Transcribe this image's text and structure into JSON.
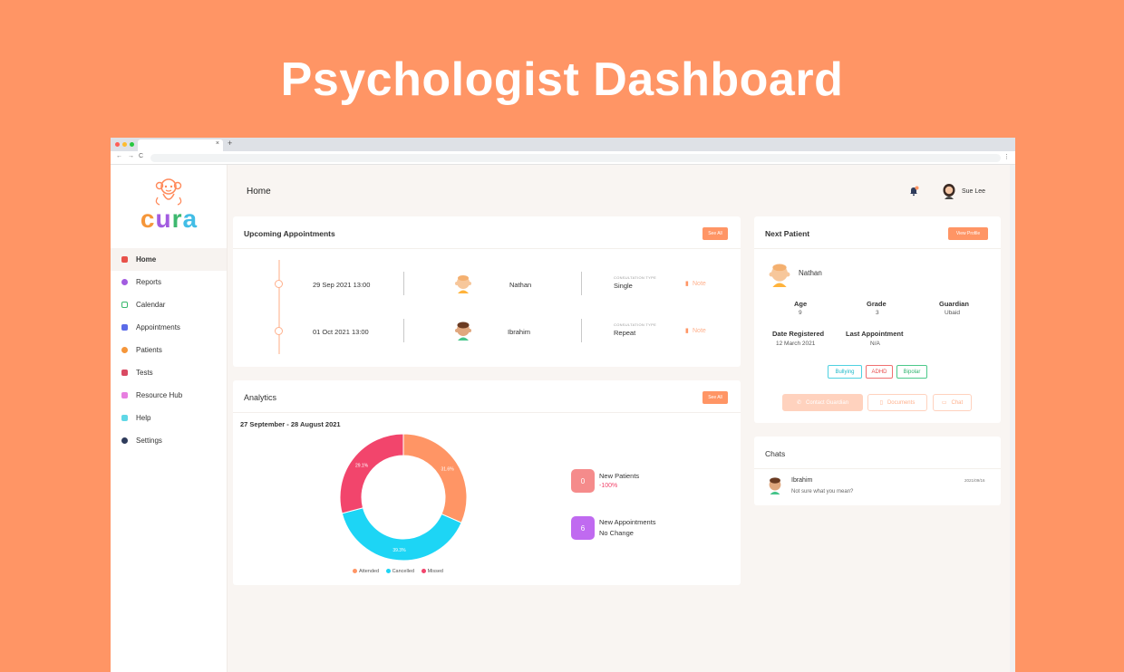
{
  "hero": {
    "title": "Psychologist Dashboard"
  },
  "browser": {
    "tab_close": "×",
    "new_tab": "+",
    "back": "←",
    "forward": "→",
    "reload": "C",
    "menu": "⋮"
  },
  "logo": {
    "text_c": "c",
    "text_u": "u",
    "text_r": "r",
    "text_a": "a"
  },
  "sidebar": {
    "items": [
      {
        "label": "Home",
        "color": "#E8514A"
      },
      {
        "label": "Reports",
        "color": "#A25CE0"
      },
      {
        "label": "Calendar",
        "color": "#37B86B"
      },
      {
        "label": "Appointments",
        "color": "#5B6BE8"
      },
      {
        "label": "Patients",
        "color": "#F5963A"
      },
      {
        "label": "Tests",
        "color": "#D94A63"
      },
      {
        "label": "Resource Hub",
        "color": "#E77FE0"
      },
      {
        "label": "Help",
        "color": "#5FD7E6"
      },
      {
        "label": "Settings",
        "color": "#2E3B5B"
      }
    ]
  },
  "topbar": {
    "title": "Home",
    "user_name": "Sue Lee"
  },
  "upcoming": {
    "title": "Upcoming Appointments",
    "see_all": "See All",
    "type_caption": "CONSULTATION TYPE",
    "note_label": "Note",
    "rows": [
      {
        "datetime": "29 Sep 2021 13:00",
        "patient": "Nathan",
        "type": "Single"
      },
      {
        "datetime": "01 Oct 2021 13:00",
        "patient": "Ibrahim",
        "type": "Repeat"
      }
    ]
  },
  "next_patient": {
    "title": "Next Patient",
    "view_profile": "View Profile",
    "name": "Nathan",
    "age_label": "Age",
    "age": "9",
    "grade_label": "Grade",
    "grade": "3",
    "guardian_label": "Guardian",
    "guardian": "Ubaid",
    "registered_label": "Date Registered",
    "registered": "12 March 2021",
    "last_label": "Last Appointment",
    "last": "N/A",
    "tags": [
      {
        "label": "Bullying",
        "color": "#4FD1E0"
      },
      {
        "label": "ADHD",
        "color": "#F07070"
      },
      {
        "label": "Bipolar",
        "color": "#4CC98A"
      }
    ],
    "contact_btn": "Contact Guardian",
    "documents_btn": "Documents",
    "chat_btn": "Chat"
  },
  "analytics": {
    "title": "Analytics",
    "see_all": "See All",
    "date_range": "27 September - 28 August 2021",
    "new_patients_value": "0",
    "new_patients_label": "New Patients",
    "new_patients_change": "-100%",
    "new_appts_value": "6",
    "new_appts_label": "New Appointments",
    "new_appts_change": "No Change",
    "colors": {
      "attended": "#FF9565",
      "cancelled": "#1DD5F5",
      "missed": "#F2456C",
      "patients_badge": "#F58B8B",
      "appts_badge": "#C06AF0"
    }
  },
  "chart_data": {
    "type": "pie",
    "donut": true,
    "categories": [
      "Attended",
      "Cancelled",
      "Missed"
    ],
    "values": [
      31.6,
      39.3,
      29.1
    ],
    "slice_labels": [
      "31.6%",
      "39.3%",
      "29.1%"
    ],
    "colors": [
      "#FF9565",
      "#1DD5F5",
      "#F2456C"
    ],
    "legend": "bottom"
  },
  "chats": {
    "title": "Chats",
    "items": [
      {
        "name": "Ibrahim",
        "message": "Not sure what you mean?",
        "date": "2021/09/16"
      }
    ]
  }
}
